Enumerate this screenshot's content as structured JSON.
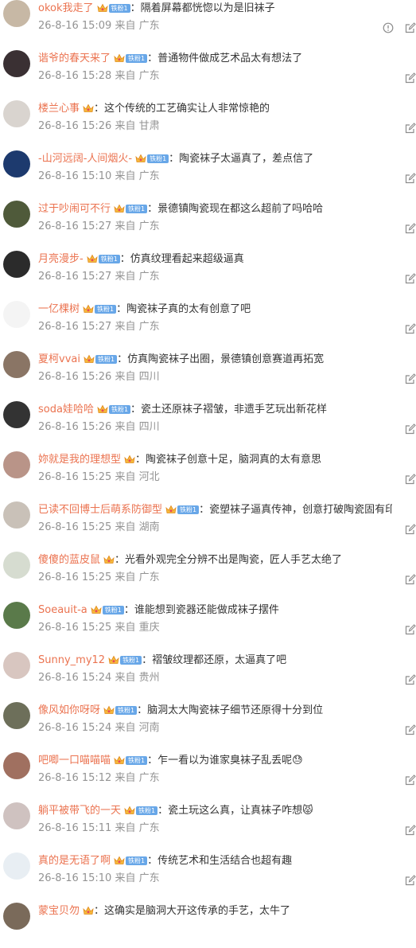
{
  "comments": [
    {
      "nick": "okok我走了",
      "fan": "铁粉1",
      "text": "：隔着屏幕都恍惚以为是旧袜子",
      "meta": "26-8-16 15:09 来自 广东",
      "avatar": "#c7b8a5",
      "fan_shown": true,
      "report": true
    },
    {
      "nick": "谐爷的春天来了",
      "fan": "铁粉1",
      "text": "：普通物件做成艺术品太有想法了",
      "meta": "26-8-16 15:28 来自 广东",
      "avatar": "#3a3033",
      "fan_shown": true
    },
    {
      "nick": "楼兰心事",
      "fan": "",
      "text": "：这个传统的工艺确实让人非常惊艳的",
      "meta": "26-8-16 15:26 来自 甘肃",
      "avatar": "#d9d4cf",
      "fan_shown": false
    },
    {
      "nick": "-山河远阔-人间烟火-",
      "fan": "铁粉1",
      "text": "：陶瓷袜子太逼真了，差点信了",
      "meta": "26-8-16 15:10 来自 广东",
      "avatar": "#1d3a6e",
      "fan_shown": true
    },
    {
      "nick": "过于吵闹可不行",
      "fan": "铁粉1",
      "text": "：景德镇陶瓷现在都这么超前了吗哈哈",
      "meta": "26-8-16 15:27 来自 广东",
      "avatar": "#4f5a3a",
      "fan_shown": true
    },
    {
      "nick": "月亮漫步-",
      "fan": "铁粉1",
      "text": "：仿真纹理看起来超级逼真",
      "meta": "26-8-16 15:27 来自 广东",
      "avatar": "#2b2b2b",
      "fan_shown": true
    },
    {
      "nick": "一亿棵树",
      "fan": "铁粉1",
      "text": "：陶瓷袜子真的太有创意了吧",
      "meta": "26-8-16 15:27 来自 广东",
      "avatar": "#f4f4f4",
      "fan_shown": true
    },
    {
      "nick": "夏柯vvai",
      "fan": "铁粉1",
      "text": "：仿真陶瓷袜子出圈，景德镇创意赛道再拓宽",
      "meta": "26-8-16 15:26 来自 四川",
      "avatar": "#8a7565",
      "fan_shown": true
    },
    {
      "nick": "soda娃哈哈",
      "fan": "铁粉1",
      "text": "：瓷土还原袜子褶皱，非遗手艺玩出新花样",
      "meta": "26-8-16 15:26 来自 四川",
      "avatar": "#333333",
      "fan_shown": true
    },
    {
      "nick": "妳就是我的理想型",
      "fan": "",
      "text": "：陶瓷袜子创意十足，脑洞真的太有意思",
      "meta": "26-8-16 15:25 来自 河北",
      "avatar": "#b99488",
      "fan_shown": false
    },
    {
      "nick": "已读不回博士后萌系防御型",
      "fan": "铁粉1",
      "text": "：瓷塑袜子逼真传神，创意打破陶瓷固有印象",
      "meta": "26-8-16 15:25 来自 湖南",
      "avatar": "#c9c1b8",
      "fan_shown": true
    },
    {
      "nick": "傻傻的蓝皮鼠",
      "fan": "",
      "text": "：光看外观完全分辨不出是陶瓷，匠人手艺太绝了",
      "meta": "26-8-16 15:25 来自 广东",
      "avatar": "#d6dcd0",
      "fan_shown": false
    },
    {
      "nick": "Soeauit-a",
      "fan": "铁粉1",
      "text": "：谁能想到瓷器还能做成袜子摆件",
      "meta": "26-8-16 15:25 来自 重庆",
      "avatar": "#5a7a4a",
      "fan_shown": true
    },
    {
      "nick": "Sunny_my12",
      "fan": "铁粉1",
      "text": "：褶皱纹理都还原，太逼真了吧",
      "meta": "26-8-16 15:24 来自 贵州",
      "avatar": "#d8c6c0",
      "fan_shown": true
    },
    {
      "nick": "像风如你呀呀",
      "fan": "铁粉1",
      "text": "：脑洞太大陶瓷袜子细节还原得十分到位",
      "meta": "26-8-16 15:24 来自 河南",
      "avatar": "#6d6f5a",
      "fan_shown": true
    },
    {
      "nick": "吧唧一口喵喵喵",
      "fan": "铁粉1",
      "text": "：乍一看以为谁家臭袜子乱丢呢😓",
      "meta": "26-8-16 15:12 来自 广东",
      "avatar": "#a07060",
      "fan_shown": true
    },
    {
      "nick": "躺平被带飞的一天",
      "fan": "铁粉1",
      "text": "：瓷土玩这么真，让真袜子咋想😾",
      "meta": "26-8-16 15:11 来自 广东",
      "avatar": "#cfc2c0",
      "fan_shown": true
    },
    {
      "nick": "真的是无语了啊",
      "fan": "铁粉1",
      "text": "：传统艺术和生活结合也超有趣",
      "meta": "26-8-16 15:10 来自 广东",
      "avatar": "#e8eef3",
      "fan_shown": true
    },
    {
      "nick": "蒙宝贝勿",
      "fan": "",
      "text": "：这确实是脑洞大开这传承的手艺，太牛了",
      "meta": "",
      "avatar": "#7a6a5a",
      "fan_shown": false
    }
  ],
  "colors": {
    "nick": "#eb7350",
    "text": "#333333",
    "meta": "#939393",
    "fan_badge": "#68a7e8"
  },
  "icons": {
    "reply": "reply-edit-icon",
    "report": "report-warning-icon",
    "crown": "crown-badge-icon"
  }
}
